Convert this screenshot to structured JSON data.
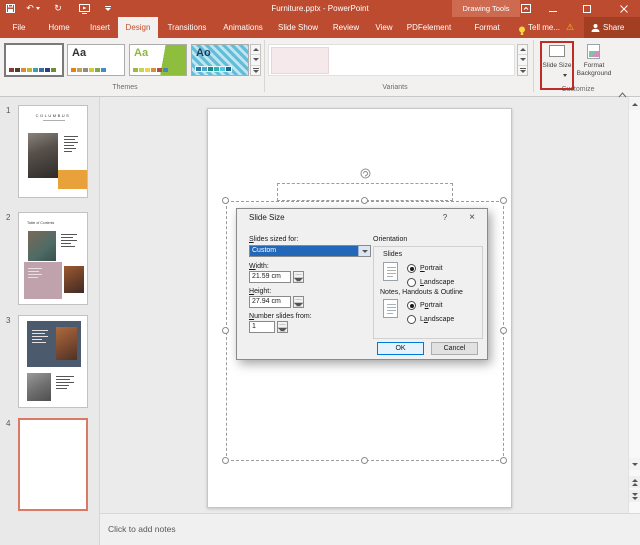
{
  "app": {
    "title": "Furniture.pptx - PowerPoint",
    "context_header": "Drawing Tools"
  },
  "titlebar_icons": {
    "undo": "↶",
    "redo": "↻"
  },
  "tabs": {
    "items": [
      "File",
      "Home",
      "Insert",
      "Design",
      "Transitions",
      "Animations",
      "Slide Show",
      "Review",
      "View",
      "PDFelement",
      "Format"
    ],
    "active": "Design",
    "tell_me": "Tell me...",
    "warning_glyph": "⚠",
    "share": "Share"
  },
  "ribbon": {
    "themes_label": "Themes",
    "variants_label": "Variants",
    "customize_label": "Customize",
    "theme_letters": [
      "",
      "Aa",
      "Aa",
      "Ao"
    ],
    "slide_size_label": "Slide Size",
    "format_background_label": "Format Background"
  },
  "slides_panel": {
    "slides": [
      {
        "number": "1",
        "title": "COLUMBUS"
      },
      {
        "number": "2",
        "title": "Table of Contents"
      },
      {
        "number": "3",
        "title": ""
      },
      {
        "number": "4",
        "title": "",
        "selected": true
      }
    ]
  },
  "dialog": {
    "title": "Slide Size",
    "help_glyph": "?",
    "close_glyph": "×",
    "sized_for_label": "Slides sized for:",
    "sized_for_value": "Custom",
    "width_label": "Width:",
    "width_value": "21.59 cm",
    "height_label": "Height:",
    "height_value": "27.94 cm",
    "number_from_label": "Number slides from:",
    "number_from_value": "1",
    "orientation_label": "Orientation",
    "slides_section_label": "Slides",
    "notes_section_label": "Notes, Handouts & Outline",
    "portrait_label": "Portrait",
    "landscape_label": "Landscape",
    "slides_orientation": "Portrait",
    "notes_orientation": "Portrait",
    "ok_label": "OK",
    "cancel_label": "Cancel"
  },
  "notes": {
    "placeholder": "Click to add notes"
  },
  "colors": {
    "titlebar_red": "#bd4b30",
    "context_header_red": "#cd6a50",
    "share_red": "#a23e22",
    "annotation_red": "#be2c26",
    "selection_blue": "#2368b8",
    "thumb_selected_border": "#db7a64",
    "warning_yellow": "#f2c811",
    "slide1_accent_orange": "#e9a23b",
    "slide2_accent_mauve": "#bfa2ab",
    "slide3_accent_slate": "#4c5a6e"
  }
}
